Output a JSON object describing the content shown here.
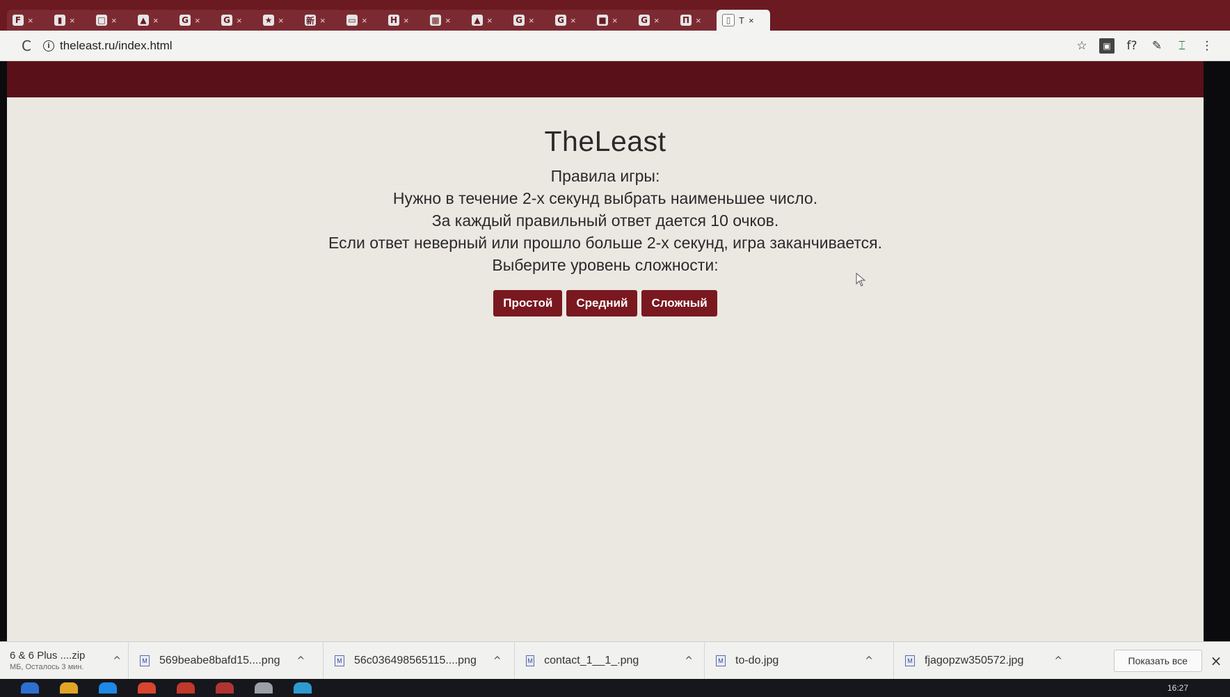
{
  "browser": {
    "tabs": [
      {
        "favicon": "F",
        "close": "×"
      },
      {
        "favicon": "▮",
        "close": "×"
      },
      {
        "favicon": "□",
        "close": "×"
      },
      {
        "favicon": "▲",
        "close": "×"
      },
      {
        "favicon": "G",
        "close": "×"
      },
      {
        "favicon": "G",
        "close": "×"
      },
      {
        "favicon": "★",
        "close": "×"
      },
      {
        "favicon": "新",
        "close": "×"
      },
      {
        "favicon": "▭",
        "close": "×"
      },
      {
        "favicon": "H",
        "close": "×"
      },
      {
        "favicon": "▩",
        "close": "×"
      },
      {
        "favicon": "▲",
        "close": "×"
      },
      {
        "favicon": "G",
        "close": "×"
      },
      {
        "favicon": "G",
        "close": "×"
      },
      {
        "favicon": "■",
        "close": "×"
      },
      {
        "favicon": "G",
        "close": "×"
      },
      {
        "favicon": "П",
        "close": "×"
      }
    ],
    "active_tab": {
      "label": "T",
      "close": "×"
    },
    "reload_glyph": "C",
    "url": "theleast.ru/index.html",
    "info_glyph": "i",
    "extensions": [
      {
        "name": "star-icon",
        "glyph": "☆"
      },
      {
        "name": "pdf-extension-icon",
        "glyph": "▣"
      },
      {
        "name": "formula-extension-icon",
        "glyph": "f?"
      },
      {
        "name": "pen-icon",
        "glyph": "✎"
      },
      {
        "name": "screen-capture-extension-icon",
        "glyph": "⌶"
      },
      {
        "name": "menu-dots-icon",
        "glyph": "⋮"
      }
    ]
  },
  "page": {
    "title": "TheLeast",
    "rules": [
      "Правила игры:",
      "Нужно в течение 2-х секунд выбрать наименьшее число.",
      "За каждый правильный ответ дается 10 очков.",
      "Если ответ неверный или прошло больше 2-х секунд, игра заканчивается.",
      "Выберите уровень сложности:"
    ],
    "levels": [
      "Простой",
      "Средний",
      "Сложный"
    ]
  },
  "downloads": {
    "first": {
      "name": "6 & 6 Plus ....zip",
      "meta": "МБ, Осталось 3 мин."
    },
    "items": [
      {
        "name": "569beabe8bafd15....png"
      },
      {
        "name": "56c036498565115....png"
      },
      {
        "name": "contact_1__1_.png"
      },
      {
        "name": "to-do.jpg"
      },
      {
        "name": "fjagopzw350572.jpg"
      }
    ],
    "file_glyph": "M",
    "caret": "^",
    "show_all": "Показать все",
    "close": "×"
  },
  "taskbar": {
    "clock": "16:27",
    "icon_colors": [
      "#2d6fd1",
      "#e0a526",
      "#1e88e5",
      "#d8452f",
      "#c0392b",
      "#b03434",
      "#9aa0a6",
      "#2e9ad0"
    ]
  }
}
